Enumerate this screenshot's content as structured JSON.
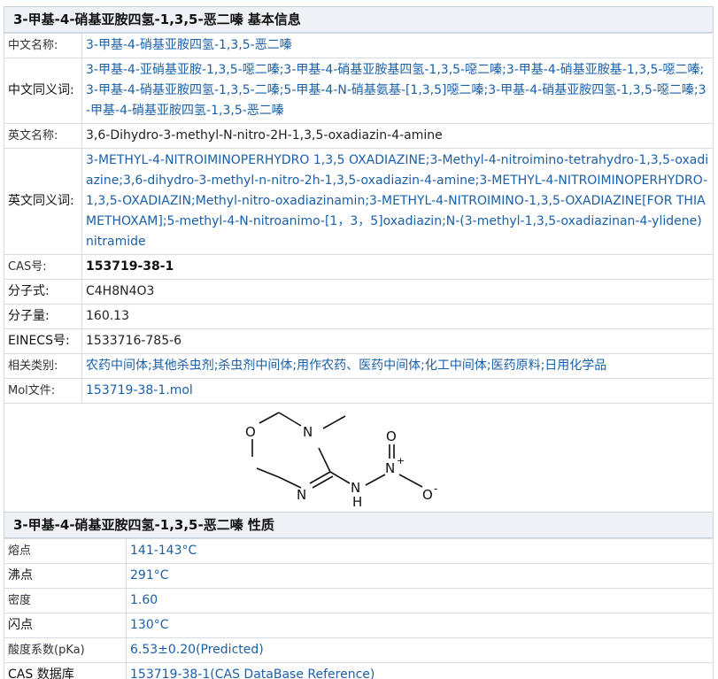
{
  "basic": {
    "title": "3-甲基-4-硝基亚胺四氢-1,3,5-恶二嗪 基本信息",
    "rows": [
      {
        "label": "中文名称:",
        "value": "3-甲基-4-硝基亚胺四氢-1,3,5-恶二嗪"
      },
      {
        "label": "中文同义词:",
        "value": "3-甲基-4-亚硝基亚胺-1,3,5-噁二嗪;3-甲基-4-硝基亚胺基四氢-1,3,5-噁二嗪;3-甲基-4-硝基亚胺基-1,3,5-噁二嗪;3-甲基-4-硝基亚胺四氢-1,3,5-二嗪;5-甲基-4-N-硝基氨基-[1,3,5]噁二嗪;3-甲基-4-硝基亚胺四氢-1,3,5-噁二嗪;3-甲基-4-硝基亚胺四氢-1,3,5-恶二嗪"
      },
      {
        "label": "英文名称:",
        "value": "3,6-Dihydro-3-methyl-N-nitro-2H-1,3,5-oxadiazin-4-amine"
      },
      {
        "label": "英文同义词:",
        "value": "3-METHYL-4-NITROIMINOPERHYDRO 1,3,5 OXADIAZINE;3-Methyl-4-nitroimino-tetrahydro-1,3,5-oxadiazine;3,6-dihydro-3-methyl-n-nitro-2h-1,3,5-oxadiazin-4-amine;3-METHYL-4-NITROIMINOPERHYDRO-1,3,5-OXADIAZIN;Methyl-nitro-oxadiazinamin;3-METHYL-4-NITROIMINO-1,3,5-OXADIAZINE[FOR THIAMETHOXAM];5-methyl-4-N-nitroanimo-[1，3，5]oxadiazin;N-(3-methyl-1,3,5-oxadiazinan-4-ylidene)nitramide"
      },
      {
        "label": "CAS号:",
        "value": "153719-38-1"
      },
      {
        "label": "分子式:",
        "value": "C4H8N4O3"
      },
      {
        "label": "分子量:",
        "value": "160.13"
      },
      {
        "label": "EINECS号:",
        "value": "1533716-785-6"
      },
      {
        "label": "相关类别:",
        "value": "农药中间体;其他杀虫剂;杀虫剂中间体;用作农药、医药中间体;化工中间体;医药原料;日用化学品"
      },
      {
        "label": "Mol文件:",
        "value": "153719-38-1.mol"
      }
    ],
    "structure_atoms": {
      "o": "O",
      "n1": "N",
      "n2": "N",
      "nh": "N",
      "h": "H",
      "nplus": "N",
      "plus": "+",
      "o2": "O",
      "o3": "O",
      "minus": "-"
    }
  },
  "props": {
    "title": "3-甲基-4-硝基亚胺四氢-1,3,5-恶二嗪 性质",
    "rows": [
      {
        "label": "熔点",
        "value": "141-143°C"
      },
      {
        "label": "沸点",
        "value": "291°C"
      },
      {
        "label": "密度",
        "value": "1.60"
      },
      {
        "label": "闪点",
        "value": "130°C"
      },
      {
        "label": "酸度系数(pKa)",
        "value": "6.53±0.20(Predicted)"
      },
      {
        "label": "CAS 数据库",
        "value": "153719-38-1(CAS DataBase Reference)"
      }
    ]
  }
}
